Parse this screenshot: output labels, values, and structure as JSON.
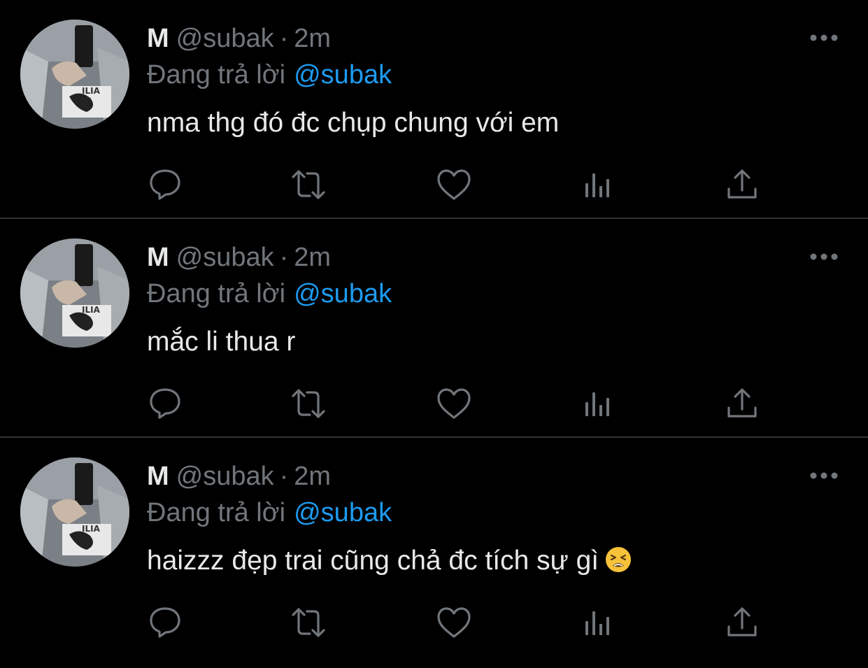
{
  "colors": {
    "background": "#000000",
    "text_primary": "#e7e9ea",
    "text_secondary": "#71767b",
    "link": "#1d9bf0",
    "divider": "#2f3336"
  },
  "tweets": [
    {
      "name": "M",
      "handle": "@subak",
      "dot": "·",
      "time": "2m",
      "reply_prefix": "Đang trả lời",
      "reply_to": "@subak",
      "text": "nma thg đó đc chụp chung với em",
      "avatar": "user-avatar-photo",
      "icons": [
        "reply-icon",
        "retweet-icon",
        "like-icon",
        "views-icon",
        "share-icon",
        "more-icon"
      ]
    },
    {
      "name": "M",
      "handle": "@subak",
      "dot": "·",
      "time": "2m",
      "reply_prefix": "Đang trả lời",
      "reply_to": "@subak",
      "text": "mắc li thua r",
      "avatar": "user-avatar-photo",
      "icons": [
        "reply-icon",
        "retweet-icon",
        "like-icon",
        "views-icon",
        "share-icon",
        "more-icon"
      ]
    },
    {
      "name": "M",
      "handle": "@subak",
      "dot": "·",
      "time": "2m",
      "reply_prefix": "Đang trả lời",
      "reply_to": "@subak",
      "text": "haizzz đẹp trai cũng chả đc tích sự gì",
      "emoji": "tired-face-emoji",
      "avatar": "user-avatar-photo",
      "icons": [
        "reply-icon",
        "retweet-icon",
        "like-icon",
        "views-icon",
        "share-icon",
        "more-icon"
      ]
    }
  ]
}
